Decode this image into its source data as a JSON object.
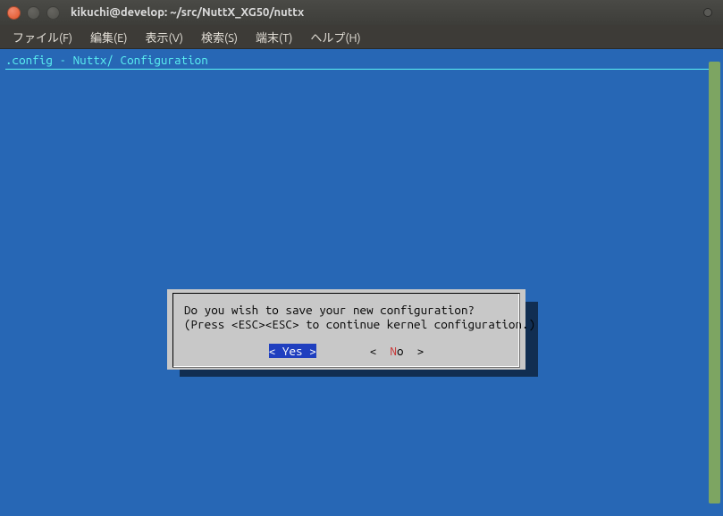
{
  "window": {
    "title": "kikuchi@develop: ~/src/NuttX_XG50/nuttx"
  },
  "menu": {
    "file": "ファイル(F)",
    "edit": "編集(E)",
    "view": "表示(V)",
    "search": "検索(S)",
    "terminal": "端末(T)",
    "help": "ヘルプ(H)"
  },
  "config": {
    "title": ".config - Nuttx/ Configuration"
  },
  "dialog": {
    "line1": "Do you wish to save your new configuration?",
    "line2": "(Press <ESC><ESC> to continue kernel configuration.)",
    "yes": "< Yes >",
    "no_left": "<  ",
    "no_hot": "N",
    "no_rest": "o  >"
  }
}
